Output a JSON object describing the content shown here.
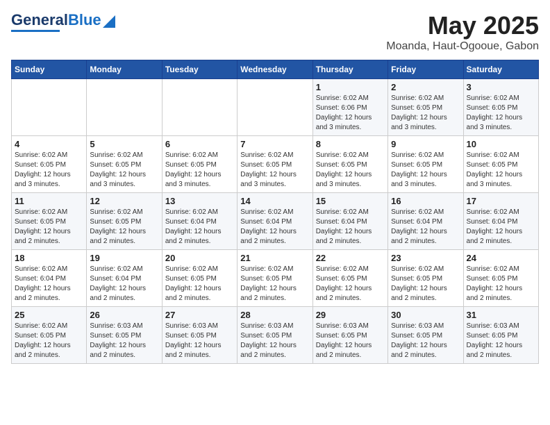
{
  "header": {
    "logo_general": "General",
    "logo_blue": "Blue",
    "month_title": "May 2025",
    "location": "Moanda, Haut-Ogooue, Gabon"
  },
  "days_of_week": [
    "Sunday",
    "Monday",
    "Tuesday",
    "Wednesday",
    "Thursday",
    "Friday",
    "Saturday"
  ],
  "weeks": [
    [
      {
        "day": "",
        "info": ""
      },
      {
        "day": "",
        "info": ""
      },
      {
        "day": "",
        "info": ""
      },
      {
        "day": "",
        "info": ""
      },
      {
        "day": "1",
        "info": "Sunrise: 6:02 AM\nSunset: 6:06 PM\nDaylight: 12 hours\nand 3 minutes."
      },
      {
        "day": "2",
        "info": "Sunrise: 6:02 AM\nSunset: 6:05 PM\nDaylight: 12 hours\nand 3 minutes."
      },
      {
        "day": "3",
        "info": "Sunrise: 6:02 AM\nSunset: 6:05 PM\nDaylight: 12 hours\nand 3 minutes."
      }
    ],
    [
      {
        "day": "4",
        "info": "Sunrise: 6:02 AM\nSunset: 6:05 PM\nDaylight: 12 hours\nand 3 minutes."
      },
      {
        "day": "5",
        "info": "Sunrise: 6:02 AM\nSunset: 6:05 PM\nDaylight: 12 hours\nand 3 minutes."
      },
      {
        "day": "6",
        "info": "Sunrise: 6:02 AM\nSunset: 6:05 PM\nDaylight: 12 hours\nand 3 minutes."
      },
      {
        "day": "7",
        "info": "Sunrise: 6:02 AM\nSunset: 6:05 PM\nDaylight: 12 hours\nand 3 minutes."
      },
      {
        "day": "8",
        "info": "Sunrise: 6:02 AM\nSunset: 6:05 PM\nDaylight: 12 hours\nand 3 minutes."
      },
      {
        "day": "9",
        "info": "Sunrise: 6:02 AM\nSunset: 6:05 PM\nDaylight: 12 hours\nand 3 minutes."
      },
      {
        "day": "10",
        "info": "Sunrise: 6:02 AM\nSunset: 6:05 PM\nDaylight: 12 hours\nand 3 minutes."
      }
    ],
    [
      {
        "day": "11",
        "info": "Sunrise: 6:02 AM\nSunset: 6:05 PM\nDaylight: 12 hours\nand 2 minutes."
      },
      {
        "day": "12",
        "info": "Sunrise: 6:02 AM\nSunset: 6:05 PM\nDaylight: 12 hours\nand 2 minutes."
      },
      {
        "day": "13",
        "info": "Sunrise: 6:02 AM\nSunset: 6:04 PM\nDaylight: 12 hours\nand 2 minutes."
      },
      {
        "day": "14",
        "info": "Sunrise: 6:02 AM\nSunset: 6:04 PM\nDaylight: 12 hours\nand 2 minutes."
      },
      {
        "day": "15",
        "info": "Sunrise: 6:02 AM\nSunset: 6:04 PM\nDaylight: 12 hours\nand 2 minutes."
      },
      {
        "day": "16",
        "info": "Sunrise: 6:02 AM\nSunset: 6:04 PM\nDaylight: 12 hours\nand 2 minutes."
      },
      {
        "day": "17",
        "info": "Sunrise: 6:02 AM\nSunset: 6:04 PM\nDaylight: 12 hours\nand 2 minutes."
      }
    ],
    [
      {
        "day": "18",
        "info": "Sunrise: 6:02 AM\nSunset: 6:04 PM\nDaylight: 12 hours\nand 2 minutes."
      },
      {
        "day": "19",
        "info": "Sunrise: 6:02 AM\nSunset: 6:04 PM\nDaylight: 12 hours\nand 2 minutes."
      },
      {
        "day": "20",
        "info": "Sunrise: 6:02 AM\nSunset: 6:05 PM\nDaylight: 12 hours\nand 2 minutes."
      },
      {
        "day": "21",
        "info": "Sunrise: 6:02 AM\nSunset: 6:05 PM\nDaylight: 12 hours\nand 2 minutes."
      },
      {
        "day": "22",
        "info": "Sunrise: 6:02 AM\nSunset: 6:05 PM\nDaylight: 12 hours\nand 2 minutes."
      },
      {
        "day": "23",
        "info": "Sunrise: 6:02 AM\nSunset: 6:05 PM\nDaylight: 12 hours\nand 2 minutes."
      },
      {
        "day": "24",
        "info": "Sunrise: 6:02 AM\nSunset: 6:05 PM\nDaylight: 12 hours\nand 2 minutes."
      }
    ],
    [
      {
        "day": "25",
        "info": "Sunrise: 6:02 AM\nSunset: 6:05 PM\nDaylight: 12 hours\nand 2 minutes."
      },
      {
        "day": "26",
        "info": "Sunrise: 6:03 AM\nSunset: 6:05 PM\nDaylight: 12 hours\nand 2 minutes."
      },
      {
        "day": "27",
        "info": "Sunrise: 6:03 AM\nSunset: 6:05 PM\nDaylight: 12 hours\nand 2 minutes."
      },
      {
        "day": "28",
        "info": "Sunrise: 6:03 AM\nSunset: 6:05 PM\nDaylight: 12 hours\nand 2 minutes."
      },
      {
        "day": "29",
        "info": "Sunrise: 6:03 AM\nSunset: 6:05 PM\nDaylight: 12 hours\nand 2 minutes."
      },
      {
        "day": "30",
        "info": "Sunrise: 6:03 AM\nSunset: 6:05 PM\nDaylight: 12 hours\nand 2 minutes."
      },
      {
        "day": "31",
        "info": "Sunrise: 6:03 AM\nSunset: 6:05 PM\nDaylight: 12 hours\nand 2 minutes."
      }
    ]
  ]
}
